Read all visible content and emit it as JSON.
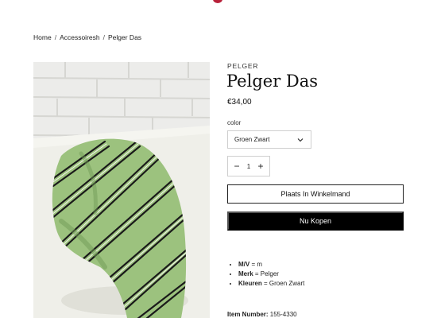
{
  "breadcrumb": {
    "home": "Home",
    "category": "Accessoiresh",
    "current": "Pelger Das",
    "separator": "/"
  },
  "product": {
    "vendor": "PELGER",
    "title": "Pelger Das",
    "price": "€34,00",
    "image_alt": "Groene stropdas met zwarte strepen"
  },
  "variant": {
    "label": "color",
    "selected": "Groen Zwart"
  },
  "quantity": {
    "value": "1",
    "decrement": "−",
    "increment": "+"
  },
  "actions": {
    "add_to_cart": "Plaats In Winkelmand",
    "buy_now": "Nu Kopen"
  },
  "specs": [
    {
      "key": "M/V",
      "value": " = m"
    },
    {
      "key": "Merk",
      "value": " = Pelger"
    },
    {
      "key": "Kleuren",
      "value": " = Groen Zwart"
    }
  ],
  "item_number": {
    "label": "Item Number:",
    "value": " 155-4330"
  },
  "colors": {
    "brand_accent": "#b8213a",
    "buy_button": "#000000",
    "tie_green": "#9cc27e"
  }
}
